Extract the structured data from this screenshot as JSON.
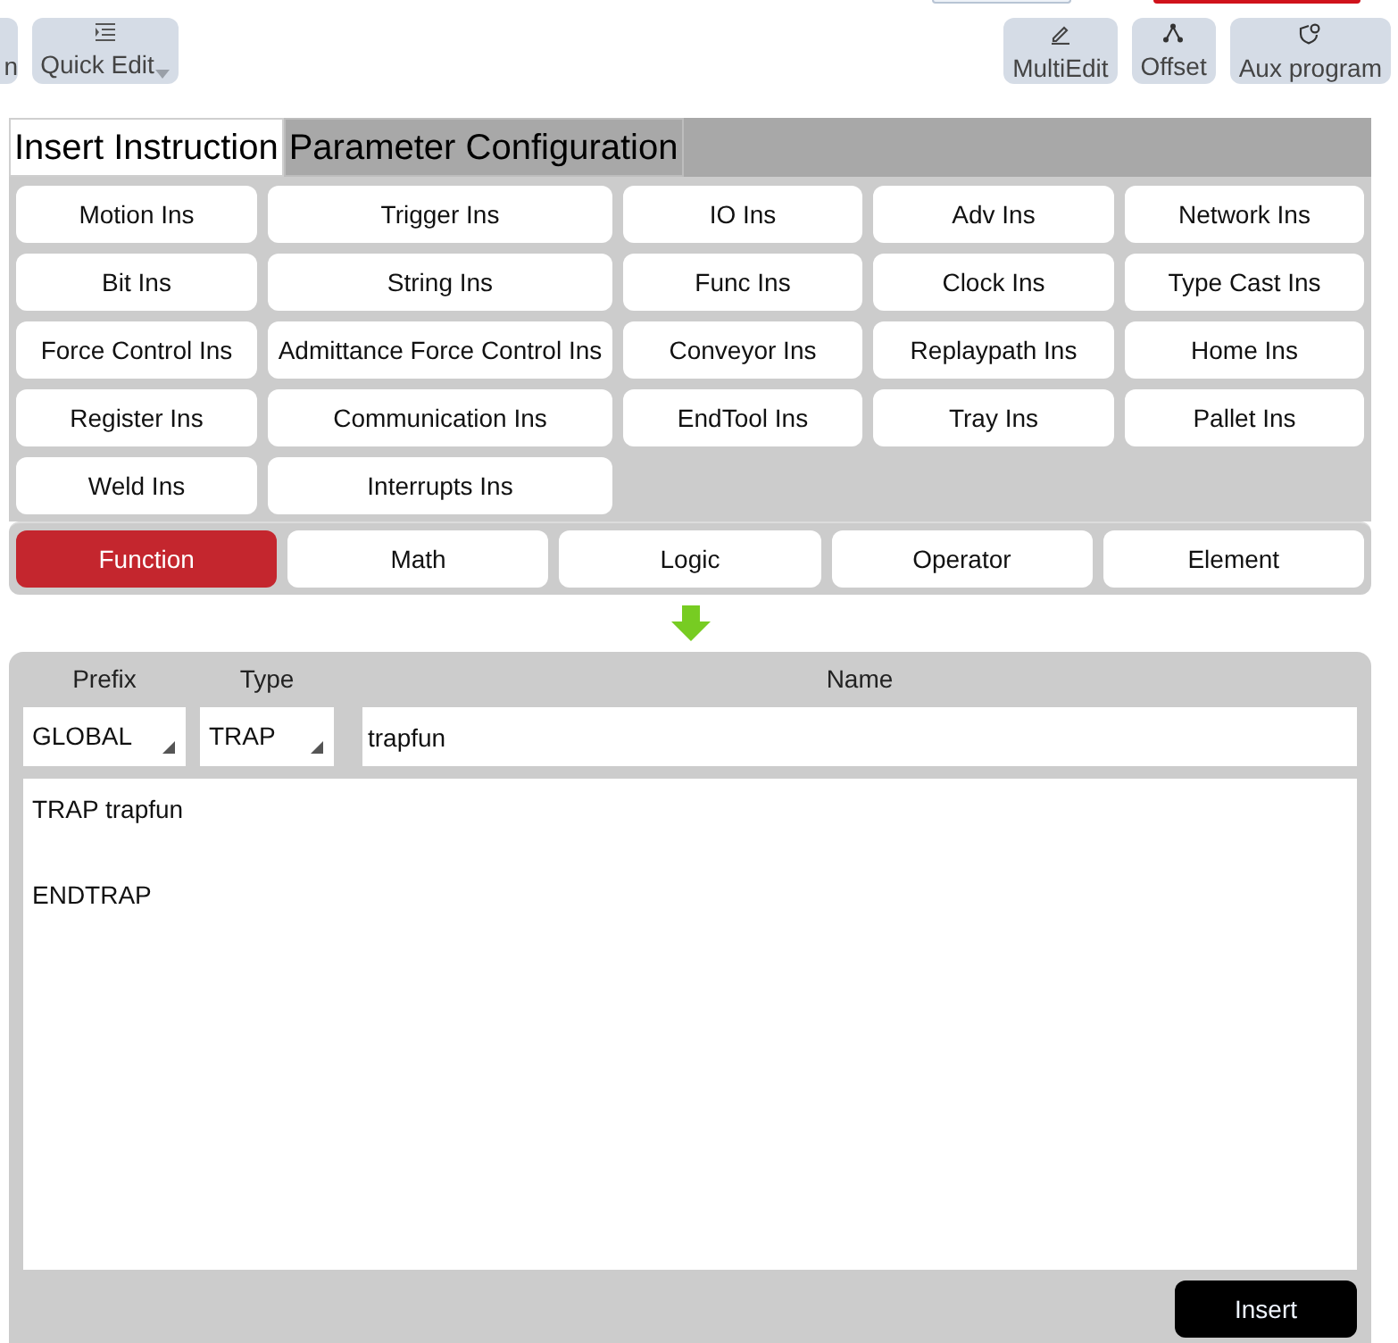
{
  "toolbar": {
    "left": [
      {
        "label": "n",
        "kind": "partial"
      },
      {
        "label": "Quick Edit",
        "kind": "menu"
      }
    ],
    "right": [
      {
        "label": "MultiEdit"
      },
      {
        "label": "Offset"
      },
      {
        "label": "Aux program"
      }
    ]
  },
  "tabs": [
    {
      "label": "Insert Instruction",
      "selected": true
    },
    {
      "label": "Parameter Configuration",
      "selected": false
    }
  ],
  "instruction_groups": [
    "Motion Ins",
    "Trigger Ins",
    "IO Ins",
    "Adv Ins",
    "Network Ins",
    "Bit Ins",
    "String Ins",
    "Func Ins",
    "Clock Ins",
    "Type Cast Ins",
    "Force Control Ins",
    "Admittance Force Control Ins",
    "Conveyor Ins",
    "Replaypath Ins",
    "Home Ins",
    "Register Ins",
    "Communication Ins",
    "EndTool Ins",
    "Tray Ins",
    "Pallet Ins",
    "Weld Ins",
    "Interrupts Ins"
  ],
  "categories": [
    {
      "label": "Function",
      "selected": true
    },
    {
      "label": "Math",
      "selected": false
    },
    {
      "label": "Logic",
      "selected": false
    },
    {
      "label": "Operator",
      "selected": false
    },
    {
      "label": "Element",
      "selected": false
    }
  ],
  "editor": {
    "columns": [
      "Prefix",
      "Type",
      "Name"
    ],
    "prefix": "GLOBAL",
    "type": "TRAP",
    "name": "trapfun",
    "code": "TRAP trapfun\n\nENDTRAP",
    "insert_button": "Insert"
  }
}
